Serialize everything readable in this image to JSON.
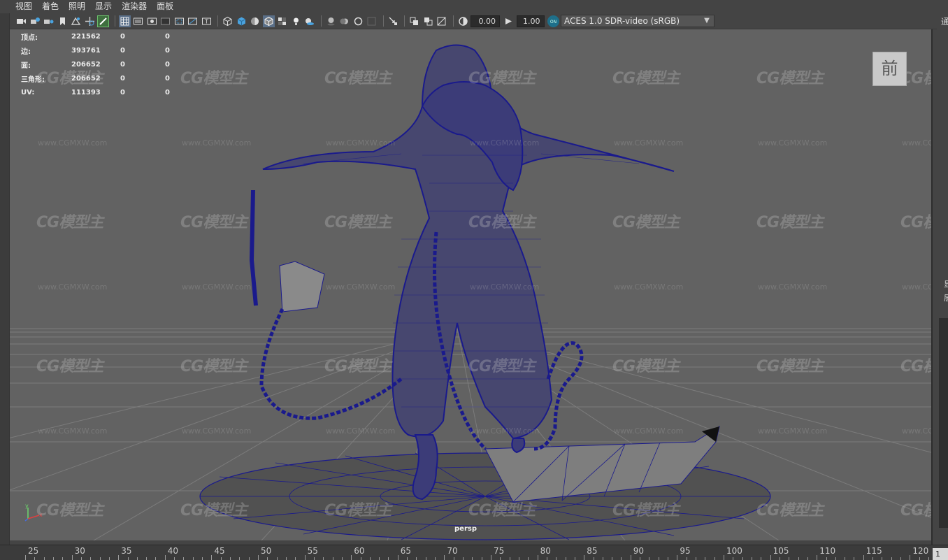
{
  "menu": [
    "视图",
    "着色",
    "照明",
    "显示",
    "渲染器",
    "面板"
  ],
  "toolbar": {
    "icons": [
      "camera-select-icon",
      "camera-attributes-icon",
      "bookmark-icon",
      "image-plane-icon",
      "grease-pencil-icon",
      "grid-icon",
      "film-gate-icon",
      "resolution-gate-icon",
      "gate-mask-icon",
      "field-chart-icon",
      "safe-action-icon",
      "wireframe-icon",
      "smooth-shade-icon",
      "default-material-icon",
      "wireframe-on-shaded-icon",
      "textured-icon",
      "use-all-lights-icon",
      "shadows-icon",
      "screen-space-ao-icon",
      "motion-blur-icon",
      "anti-aliasing-icon",
      "isolate-select-icon",
      "xray-icon",
      "xray-joints-icon",
      "backface-culling-icon",
      "exposure-icon",
      "gamma-icon",
      "color-management-icon"
    ],
    "exposure_value": "0.00",
    "gamma_value": "1.00",
    "color_space": "ACES 1.0 SDR-video (sRGB)"
  },
  "hud": {
    "rows": [
      {
        "label": "顶点:",
        "v1": "221562",
        "v2": "0",
        "v3": "0"
      },
      {
        "label": "边:",
        "v1": "393761",
        "v2": "0",
        "v3": "0"
      },
      {
        "label": "面:",
        "v1": "206652",
        "v2": "0",
        "v3": "0"
      },
      {
        "label": "三角形:",
        "v1": "206652",
        "v2": "0",
        "v3": "0"
      },
      {
        "label": "UV:",
        "v1": "111393",
        "v2": "0",
        "v3": "0"
      }
    ]
  },
  "viewcube_label": "前",
  "camera_label": "persp",
  "watermark": {
    "logo": "CG模型主",
    "url": "www.CGMXW.com"
  },
  "right_panel": {
    "top_text": "通",
    "side_text_1": "显",
    "side_text_2": "层"
  },
  "timeline": {
    "ticks": [
      "25",
      "30",
      "35",
      "40",
      "45",
      "50",
      "55",
      "60",
      "65",
      "70",
      "75",
      "80",
      "85",
      "90",
      "95",
      "100",
      "105",
      "110",
      "115",
      "120"
    ],
    "current_frame": "1"
  },
  "colors": {
    "wireframe": "#1a1a8c",
    "viewport_bg": "#626262",
    "grid": "#7c7c7c"
  }
}
